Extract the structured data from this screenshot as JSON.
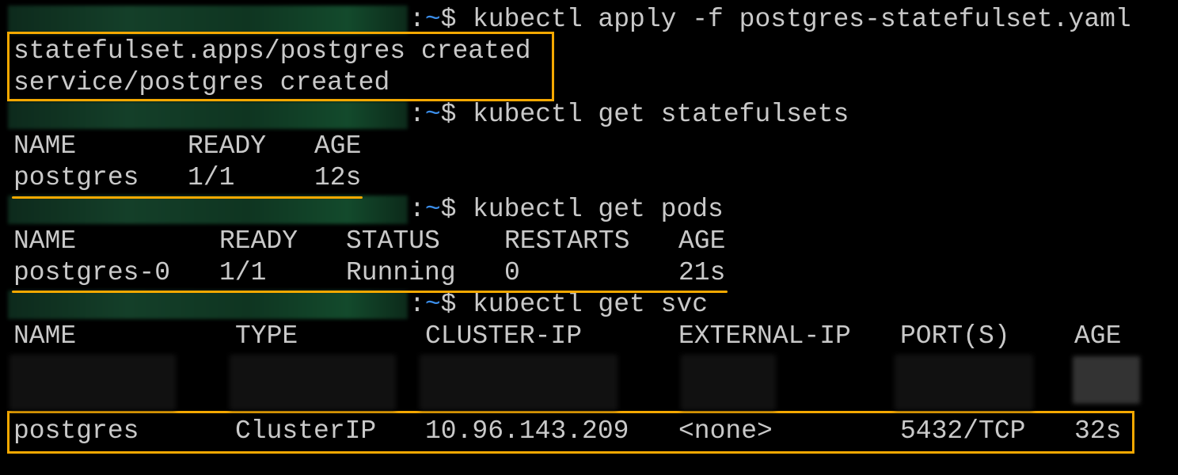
{
  "terminal": {
    "prompt_suffix": ":",
    "prompt_tilde": "~",
    "prompt_dollar": "$",
    "commands": [
      "kubectl apply -f postgres-statefulset.yaml",
      "kubectl get statefulsets",
      "kubectl get pods",
      "kubectl get svc"
    ],
    "apply_output": [
      "statefulset.apps/postgres created",
      "service/postgres created"
    ],
    "statefulsets": {
      "headers": [
        "NAME",
        "READY",
        "AGE"
      ],
      "rows": [
        [
          "postgres",
          "1/1",
          "12s"
        ]
      ]
    },
    "pods": {
      "headers": [
        "NAME",
        "READY",
        "STATUS",
        "RESTARTS",
        "AGE"
      ],
      "rows": [
        [
          "postgres-0",
          "1/1",
          "Running",
          "0",
          "21s"
        ]
      ]
    },
    "svc": {
      "headers": [
        "NAME",
        "TYPE",
        "CLUSTER-IP",
        "EXTERNAL-IP",
        "PORT(S)",
        "AGE"
      ],
      "rows": [
        [
          "postgres",
          "ClusterIP",
          "10.96.143.209",
          "<none>",
          "5432/TCP",
          "32s"
        ]
      ]
    },
    "colors": {
      "highlight": "#f5a800",
      "tilde": "#3b8eea",
      "text": "#c9c9c9",
      "background": "#000000"
    }
  }
}
